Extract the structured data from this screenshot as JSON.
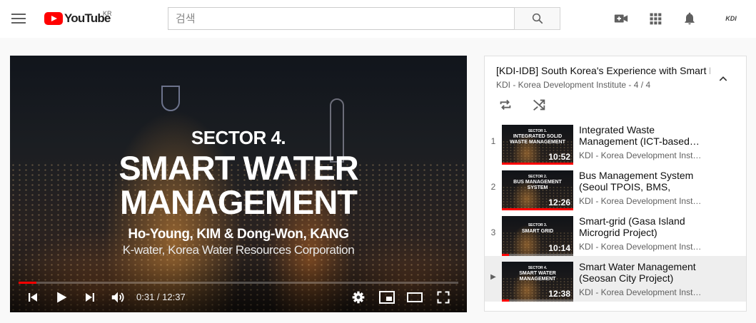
{
  "masthead": {
    "logo_text": "YouTube",
    "region": "KR",
    "search_placeholder": "검색",
    "avatar_text": "KDI"
  },
  "player": {
    "overlay": {
      "sector": "SECTOR 4.",
      "title_line1": "SMART WATER",
      "title_line2": "MANAGEMENT",
      "authors": "Ho-Young, KIM & Dong-Won, KANG",
      "organization": "K-water, Korea Water Resources Corporation"
    },
    "current_time": "0:31",
    "duration": "12:37",
    "time_display": "0:31 / 12:37",
    "progress_fraction": 0.041
  },
  "playlist": {
    "title": "[KDI-IDB] South Korea's Experience with Smart Infrastructure",
    "channel": "KDI - Korea Development Institute",
    "position": "4 / 4",
    "subtitle": "KDI - Korea Development Institute - 4 / 4",
    "items": [
      {
        "index": "1",
        "title": "Integrated Waste Management (ICT-based…",
        "channel": "KDI - Korea Development Inst…",
        "duration": "10:52",
        "thumb_sector": "SECTOR 1.",
        "thumb_title": "INTEGRATED SOLID WASTE MANAGEMENT",
        "watched_fraction": 1.0
      },
      {
        "index": "2",
        "title": "Bus Management System (Seoul TPOIS, BMS, Dajeo…",
        "channel": "KDI - Korea Development Inst…",
        "duration": "12:26",
        "thumb_sector": "SECTOR 2.",
        "thumb_title": "BUS MANAGEMENT SYSTEM",
        "watched_fraction": 1.0
      },
      {
        "index": "3",
        "title": "Smart-grid (Gasa Island Microgrid Project)",
        "channel": "KDI - Korea Development Inst…",
        "duration": "10:14",
        "thumb_sector": "SECTOR 3.",
        "thumb_title": "SMART GRID",
        "watched_fraction": 0.1
      },
      {
        "index": "▶",
        "title": "Smart Water Management (Seosan City Project)",
        "channel": "KDI - Korea Development Inst…",
        "duration": "12:38",
        "thumb_sector": "SECTOR 4.",
        "thumb_title": "SMART WATER MANAGEMENT",
        "watched_fraction": 0.1,
        "active": true
      }
    ]
  },
  "colors": {
    "brand_red": "#ff0000",
    "background": "#f9f9f9",
    "active_row": "#eeeeee"
  }
}
